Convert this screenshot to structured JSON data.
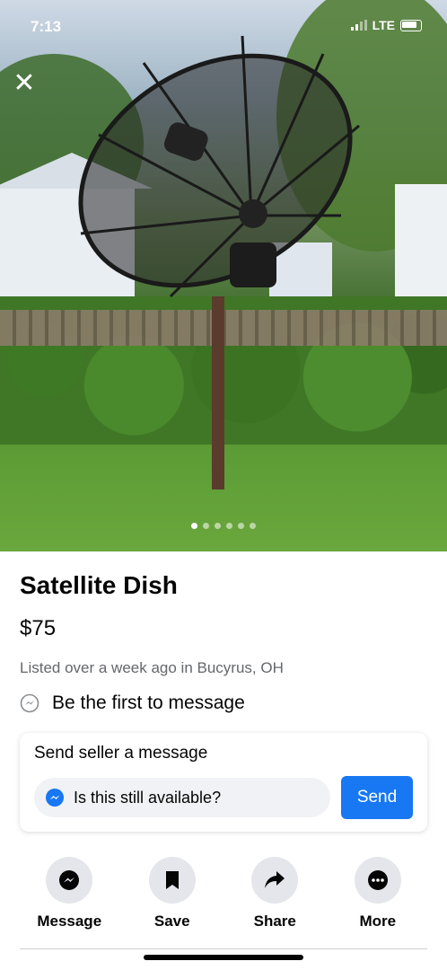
{
  "status_bar": {
    "time": "7:13",
    "network": "LTE"
  },
  "photo": {
    "page_count": 6,
    "active_index": 0
  },
  "listing": {
    "title": "Satellite Dish",
    "price": "$75",
    "listed": "Listed over a week ago in Bucyrus, OH",
    "first_message": "Be the first to message"
  },
  "message_card": {
    "title": "Send seller a message",
    "input_value": "Is this still available?",
    "send_label": "Send"
  },
  "actions": [
    {
      "label": "Message",
      "icon": "messenger-icon"
    },
    {
      "label": "Save",
      "icon": "bookmark-icon"
    },
    {
      "label": "Share",
      "icon": "share-arrow-icon"
    },
    {
      "label": "More",
      "icon": "more-dots-icon"
    }
  ],
  "colors": {
    "accent": "#1877f2",
    "secondary_text": "#65676b",
    "button_bg": "#e4e6eb"
  }
}
